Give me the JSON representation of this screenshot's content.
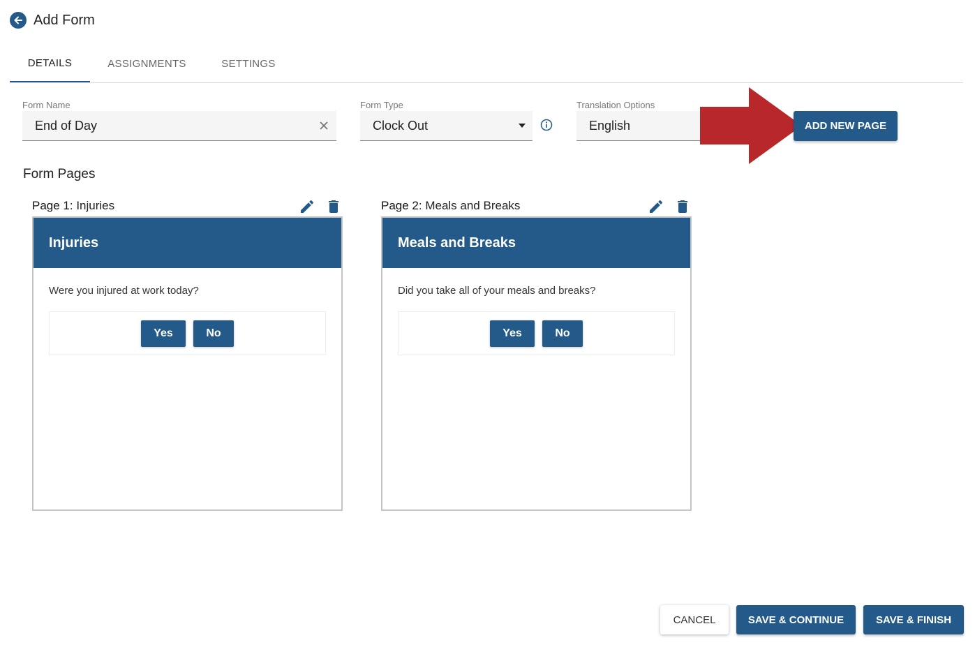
{
  "header": {
    "title": "Add Form",
    "back_icon": "arrow-left-icon"
  },
  "tabs": [
    {
      "label": "DETAILS",
      "active": true
    },
    {
      "label": "ASSIGNMENTS",
      "active": false
    },
    {
      "label": "SETTINGS",
      "active": false
    }
  ],
  "fields": {
    "form_name": {
      "label": "Form Name",
      "value": "End of Day"
    },
    "form_type": {
      "label": "Form Type",
      "value": "Clock Out"
    },
    "translation": {
      "label": "Translation Options",
      "value": "English"
    }
  },
  "actions": {
    "add_new_page": "ADD NEW PAGE",
    "cancel": "CANCEL",
    "save_continue": "SAVE & CONTINUE",
    "save_finish": "SAVE & FINISH"
  },
  "section_title": "Form Pages",
  "pages": [
    {
      "label_prefix": "Page 1:",
      "label_name": " Injuries",
      "header": "Injuries",
      "question": "Were you injured at work today?",
      "yes": "Yes",
      "no": "No"
    },
    {
      "label_prefix": "Page 2:",
      "label_name": " Meals and Breaks",
      "header": "Meals and Breaks",
      "question": "Did you take all of your meals and breaks?",
      "yes": "Yes",
      "no": "No"
    }
  ],
  "colors": {
    "primary": "#235a8a",
    "annotation_arrow": "#b8282a"
  }
}
